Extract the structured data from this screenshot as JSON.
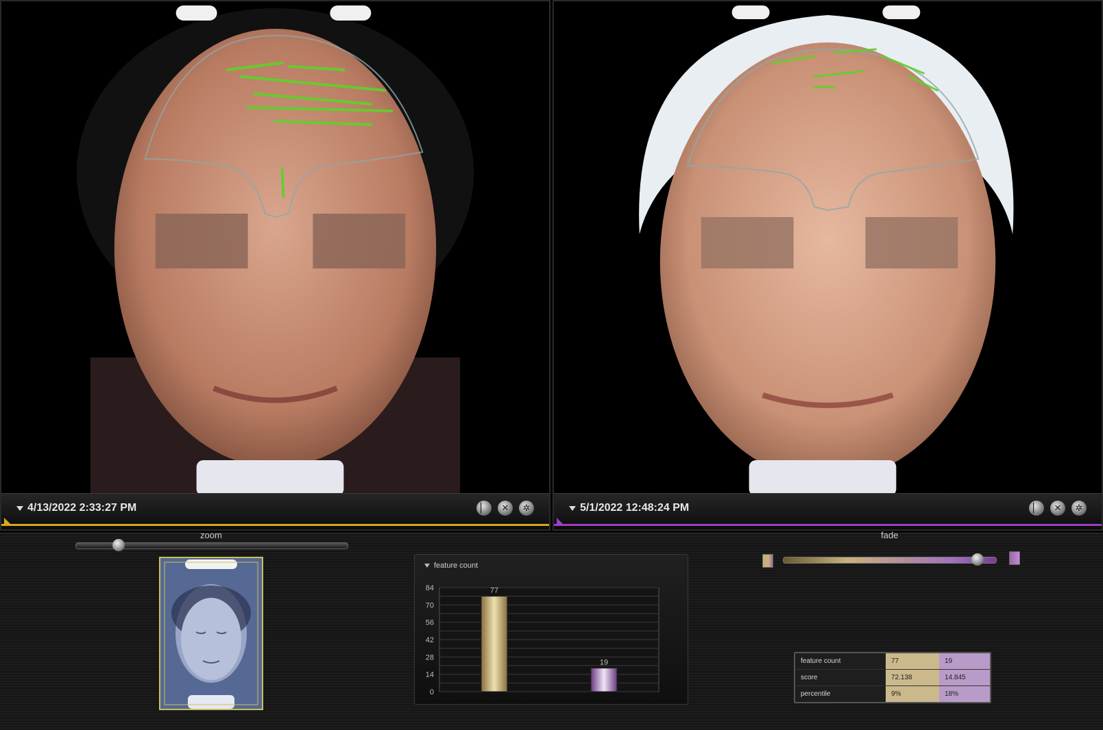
{
  "left_pane": {
    "date": "4/13/2022 2:33:27 PM",
    "accent": "#d9a620"
  },
  "right_pane": {
    "date": "5/1/2022 12:48:24 PM",
    "accent": "#9b3fc6"
  },
  "pane_buttons": [
    "toggle-icon",
    "close-icon",
    "settings-icon"
  ],
  "zoom": {
    "label": "zoom",
    "value": 0.14
  },
  "fade": {
    "label": "fade",
    "value": 0.94
  },
  "panel": {
    "title": "feature count"
  },
  "chart_data": {
    "type": "bar",
    "categories": [
      "4/13/2022 2:33:27 PM",
      "5/1/2022 12:48:24 PM"
    ],
    "values": [
      77,
      19
    ],
    "ylim": [
      0,
      84
    ],
    "yticks": [
      0,
      14,
      28,
      42,
      56,
      70,
      84
    ],
    "data_labels": [
      "77",
      "19"
    ],
    "colors": [
      "#c8b27a",
      "#9a6aa8"
    ],
    "grid": true
  },
  "metrics": {
    "rows": [
      {
        "label": "feature count",
        "a": "77",
        "b": "19"
      },
      {
        "label": "score",
        "a": "72.138",
        "b": "14.845"
      },
      {
        "label": "percentile",
        "a": "9%",
        "b": "18%"
      }
    ]
  },
  "colors": {
    "gold": "#c8b27a",
    "purple": "#b89bc8"
  }
}
